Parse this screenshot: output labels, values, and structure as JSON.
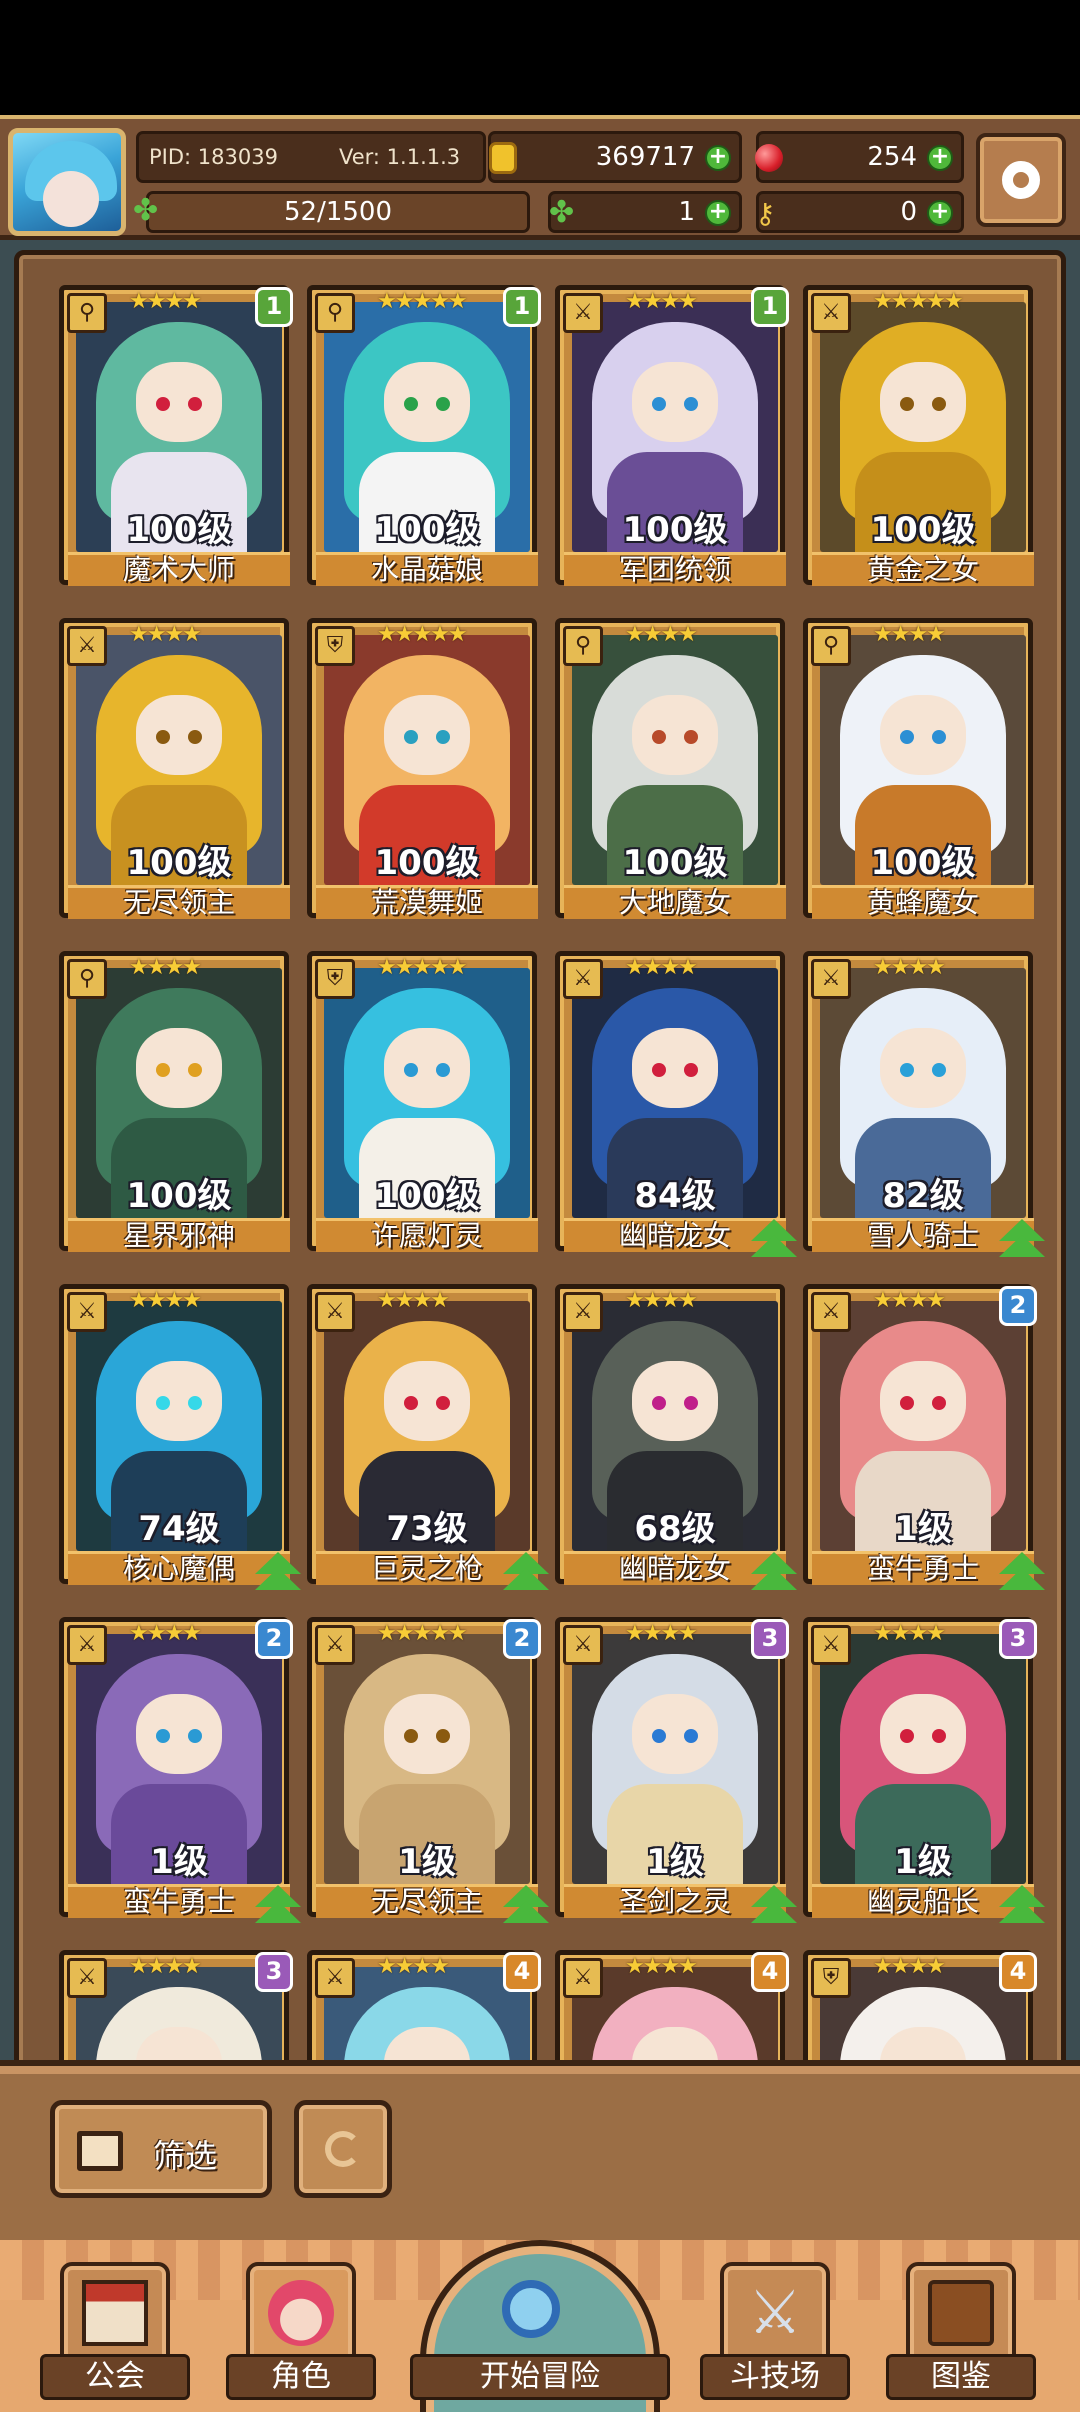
{
  "header": {
    "pid": "PID: 183039",
    "version": "Ver: 1.1.1.3",
    "gold": "369717",
    "gems": "254",
    "stamina": "52/1500",
    "clover": "1",
    "keys": "0",
    "icons": {
      "gold": "coin-icon",
      "gems": "ruby-icon",
      "stamina": "clover-icon",
      "clover": "clover-icon",
      "keys": "key-icon",
      "settings": "gear-icon"
    }
  },
  "cards": [
    {
      "level": "100级",
      "name": "魔术大师",
      "stars": "★★★★",
      "badge": "1",
      "badge_color": "#58a53a",
      "class_icon": "wand-icon",
      "class_glyph": "⚲",
      "upgrade": false,
      "hair": "#5fb9a0",
      "outfit": "#e8e4ef",
      "bg": "#2c3f55",
      "eye": "#d11f3d"
    },
    {
      "level": "100级",
      "name": "水晶菇娘",
      "stars": "★★★★★",
      "badge": "1",
      "badge_color": "#58a53a",
      "class_icon": "wand-icon",
      "class_glyph": "⚲",
      "upgrade": false,
      "hair": "#3cc6c4",
      "outfit": "#f4f4f4",
      "bg": "#2a6ea8",
      "eye": "#2aa24a"
    },
    {
      "level": "100级",
      "name": "军团统领",
      "stars": "★★★★",
      "badge": "1",
      "badge_color": "#58a53a",
      "class_icon": "sword-icon",
      "class_glyph": "⚔",
      "upgrade": false,
      "hair": "#d8d0ee",
      "outfit": "#6a4e96",
      "bg": "#3b2f55",
      "eye": "#2c8fd4"
    },
    {
      "level": "100级",
      "name": "黄金之女",
      "stars": "★★★★★",
      "badge": "",
      "badge_color": "",
      "class_icon": "sword-icon",
      "class_glyph": "⚔",
      "upgrade": false,
      "hair": "#e0ae24",
      "outfit": "#c58f1a",
      "bg": "#5c4a2a",
      "eye": "#8a5a10"
    },
    {
      "level": "100级",
      "name": "无尽领主",
      "stars": "★★★★",
      "badge": "",
      "badge_color": "",
      "class_icon": "sword-icon",
      "class_glyph": "⚔",
      "upgrade": false,
      "hair": "#e7b52c",
      "outfit": "#c89120",
      "bg": "#4a5468",
      "eye": "#8a5a10"
    },
    {
      "level": "100级",
      "name": "荒漠舞姬",
      "stars": "★★★★★",
      "badge": "",
      "badge_color": "",
      "class_icon": "shield-icon",
      "class_glyph": "⛨",
      "upgrade": false,
      "hair": "#f2b463",
      "outfit": "#d23a2a",
      "bg": "#8a3a2c",
      "eye": "#2aa0c0"
    },
    {
      "level": "100级",
      "name": "大地魔女",
      "stars": "★★★★",
      "badge": "",
      "badge_color": "",
      "class_icon": "wand-icon",
      "class_glyph": "⚲",
      "upgrade": false,
      "hair": "#d8dcd8",
      "outfit": "#4c6e48",
      "bg": "#37503c",
      "eye": "#b84a2a"
    },
    {
      "level": "100级",
      "name": "黄蜂魔女",
      "stars": "★★★★",
      "badge": "",
      "badge_color": "",
      "class_icon": "wand-icon",
      "class_glyph": "⚲",
      "upgrade": false,
      "hair": "#eef2f8",
      "outfit": "#c87a2a",
      "bg": "#5a4a3a",
      "eye": "#2c8fd4"
    },
    {
      "level": "100级",
      "name": "星界邪神",
      "stars": "★★★★",
      "badge": "",
      "badge_color": "",
      "class_icon": "wand-icon",
      "class_glyph": "⚲",
      "upgrade": false,
      "hair": "#3f7a5c",
      "outfit": "#2e5a44",
      "bg": "#2c3c34",
      "eye": "#e0a020"
    },
    {
      "level": "100级",
      "name": "许愿灯灵",
      "stars": "★★★★★",
      "badge": "",
      "badge_color": "",
      "class_icon": "shield-icon",
      "class_glyph": "⛨",
      "upgrade": false,
      "hair": "#36c0e0",
      "outfit": "#f4f0e8",
      "bg": "#1f5f8a",
      "eye": "#2a9ad4"
    },
    {
      "level": "84级",
      "name": "幽暗龙女",
      "stars": "★★★★",
      "badge": "",
      "badge_color": "",
      "class_icon": "sword-icon",
      "class_glyph": "⚔",
      "upgrade": true,
      "hair": "#2a58a8",
      "outfit": "#2a3a5a",
      "bg": "#1f2b44",
      "eye": "#d11f3d"
    },
    {
      "level": "82级",
      "name": "雪人骑士",
      "stars": "★★★★",
      "badge": "",
      "badge_color": "",
      "class_icon": "sword-icon",
      "class_glyph": "⚔",
      "upgrade": true,
      "hair": "#e6eef8",
      "outfit": "#4a6a98",
      "bg": "#5c4a36",
      "eye": "#2aa0d8"
    },
    {
      "level": "74级",
      "name": "核心魔偶",
      "stars": "★★★★",
      "badge": "",
      "badge_color": "",
      "class_icon": "sword-icon",
      "class_glyph": "⚔",
      "upgrade": true,
      "hair": "#2aa6d8",
      "outfit": "#1e3e58",
      "bg": "#1e3a40",
      "eye": "#36d8e8"
    },
    {
      "level": "73级",
      "name": "巨灵之枪",
      "stars": "★★★★",
      "badge": "",
      "badge_color": "",
      "class_icon": "sword-icon",
      "class_glyph": "⚔",
      "upgrade": true,
      "hair": "#eab24a",
      "outfit": "#2a2a34",
      "bg": "#5a3a2a",
      "eye": "#d11f3d"
    },
    {
      "level": "68级",
      "name": "幽暗龙女",
      "stars": "★★★★",
      "badge": "",
      "badge_color": "",
      "class_icon": "sword-icon",
      "class_glyph": "⚔",
      "upgrade": true,
      "hair": "#586058",
      "outfit": "#2a2c30",
      "bg": "#2a2c34",
      "eye": "#c01f8a"
    },
    {
      "level": "1级",
      "name": "蛮牛勇士",
      "stars": "★★★★",
      "badge": "2",
      "badge_color": "#3a88d0",
      "class_icon": "sword-icon",
      "class_glyph": "⚔",
      "upgrade": true,
      "hair": "#e88a8a",
      "outfit": "#e8d8c8",
      "bg": "#5c4034",
      "eye": "#d11f3d"
    },
    {
      "level": "1级",
      "name": "蛮牛勇士",
      "stars": "★★★★",
      "badge": "2",
      "badge_color": "#3a88d0",
      "class_icon": "sword-icon",
      "class_glyph": "⚔",
      "upgrade": true,
      "hair": "#8a6ab8",
      "outfit": "#6a4a9a",
      "bg": "#3a3058",
      "eye": "#2a9ad4"
    },
    {
      "level": "1级",
      "name": "无尽领主",
      "stars": "★★★★★",
      "badge": "2",
      "badge_color": "#3a88d0",
      "class_icon": "sword-icon",
      "class_glyph": "⚔",
      "upgrade": true,
      "hair": "#d8b884",
      "outfit": "#c8a470",
      "bg": "#6a5038",
      "eye": "#8a5a10"
    },
    {
      "level": "1级",
      "name": "圣剑之灵",
      "stars": "★★★★",
      "badge": "3",
      "badge_color": "#9a5ab8",
      "class_icon": "sword-icon",
      "class_glyph": "⚔",
      "upgrade": true,
      "hair": "#d4dce6",
      "outfit": "#e8d6a8",
      "bg": "#3c3a3a",
      "eye": "#2a7ad4"
    },
    {
      "level": "1级",
      "name": "幽灵船长",
      "stars": "★★★★",
      "badge": "3",
      "badge_color": "#9a5ab8",
      "class_icon": "sword-icon",
      "class_glyph": "⚔",
      "upgrade": true,
      "hair": "#d8557a",
      "outfit": "#3c6a5a",
      "bg": "#2c3a34",
      "eye": "#d11f3d"
    },
    {
      "level": "",
      "name": "",
      "stars": "★★★★",
      "badge": "3",
      "badge_color": "#9a5ab8",
      "class_icon": "sword-icon",
      "class_glyph": "⚔",
      "upgrade": false,
      "hair": "#f0eadc",
      "outfit": "#e8e0d0",
      "bg": "#3a4a58",
      "eye": "#d4a02a"
    },
    {
      "level": "",
      "name": "",
      "stars": "★★★★",
      "badge": "4",
      "badge_color": "#d8882a",
      "class_icon": "sword-icon",
      "class_glyph": "⚔",
      "upgrade": false,
      "hair": "#8ad8e8",
      "outfit": "#e8e0d0",
      "bg": "#3a5a7a",
      "eye": "#2a9ad4"
    },
    {
      "level": "",
      "name": "",
      "stars": "★★★★",
      "badge": "4",
      "badge_color": "#d8882a",
      "class_icon": "sword-icon",
      "class_glyph": "⚔",
      "upgrade": false,
      "hair": "#f2b0c0",
      "outfit": "#e8c090",
      "bg": "#5a3a2a",
      "eye": "#8a5a10"
    },
    {
      "level": "",
      "name": "",
      "stars": "★★★★",
      "badge": "4",
      "badge_color": "#d8882a",
      "class_icon": "shield-icon",
      "class_glyph": "⛨",
      "upgrade": false,
      "hair": "#f4f0ec",
      "outfit": "#c84a4a",
      "bg": "#4a3a36",
      "eye": "#d11f3d"
    }
  ],
  "filter": {
    "label": "筛选",
    "icon": "grid-icon",
    "refresh_icon": "refresh-icon"
  },
  "nav": {
    "guild": {
      "label": "公会",
      "icon": "house-icon"
    },
    "character": {
      "label": "角色",
      "icon": "character-icon"
    },
    "adventure": {
      "label": "开始冒险",
      "icon": "magnifier-icon"
    },
    "arena": {
      "label": "斗技场",
      "icon": "crossed-swords-icon"
    },
    "codex": {
      "label": "图鉴",
      "icon": "book-icon"
    }
  }
}
